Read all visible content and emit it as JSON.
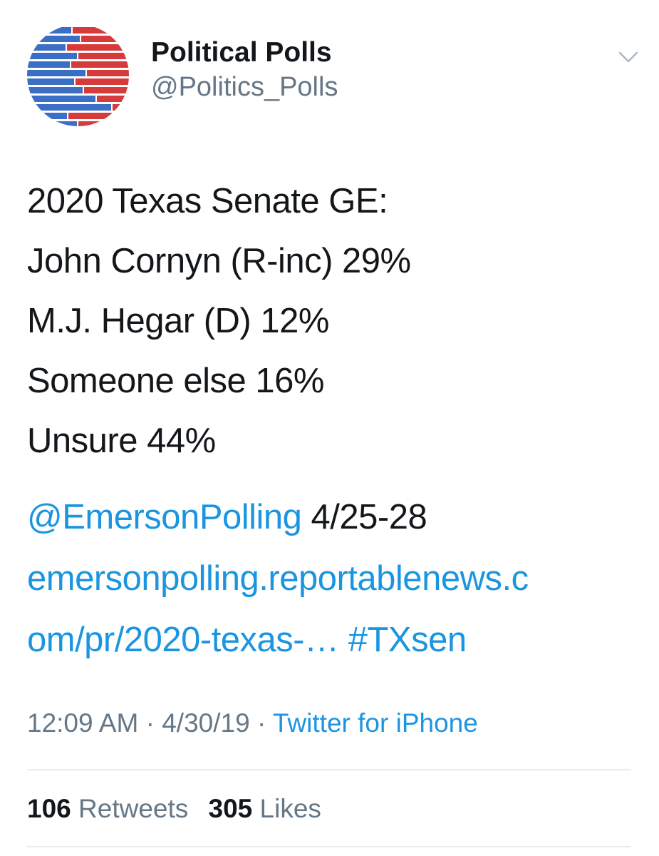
{
  "account": {
    "display_name": "Political Polls",
    "handle": "@Politics_Polls",
    "avatar_icon": "political-polls-logo-icon",
    "menu_icon": "chevron-down-icon"
  },
  "tweet": {
    "lines": [
      "2020 Texas Senate GE:",
      "John Cornyn (R-inc) 29%",
      "M.J. Hegar (D) 12%",
      "Someone else 16%",
      "Unsure 44%"
    ],
    "mention": "@EmersonPolling",
    "date_range": " 4/25-28",
    "url_line1": "emersonpolling.reportablenews.c",
    "url_line2": "om/pr/2020-texas-…",
    "hashtag": "#TXsen"
  },
  "meta": {
    "time": "12:09 AM",
    "separator": " · ",
    "date": "4/30/19",
    "source": "Twitter for iPhone"
  },
  "stats": {
    "retweets_count": "106",
    "retweets_label": "Retweets",
    "likes_count": "305",
    "likes_label": "Likes"
  },
  "colors": {
    "link": "#1b95e0",
    "text": "#14171a",
    "muted": "#657786",
    "avatar_blue": "#3b6fc6",
    "avatar_red": "#d63a3a"
  }
}
